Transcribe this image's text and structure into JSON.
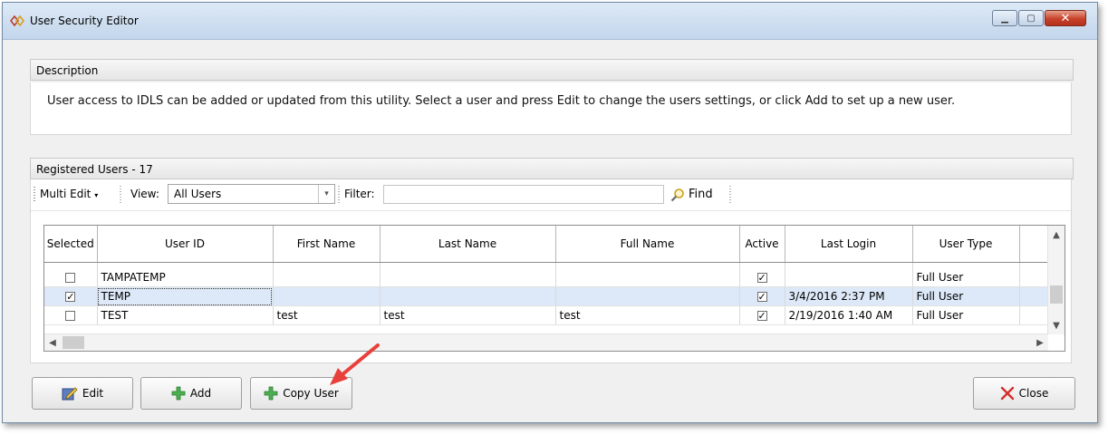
{
  "window": {
    "title": "User Security Editor"
  },
  "description": {
    "header": "Description",
    "text": "User access to IDLS can be added or updated from this utility.  Select a user and press Edit to change the users settings, or click Add to set up a new user."
  },
  "users": {
    "header": "Registered Users - 17",
    "toolbar": {
      "multi_edit": "Multi Edit",
      "view_label": "View:",
      "view_value": "All Users",
      "filter_label": "Filter:",
      "filter_value": "",
      "find_label": "Find"
    },
    "columns": [
      "Selected",
      "User ID",
      "First Name",
      "Last Name",
      "Full Name",
      "Active",
      "Last Login",
      "User Type"
    ],
    "rows": [
      {
        "selected": false,
        "user_id": "TAMPATEMP",
        "first": "",
        "last": "",
        "full": "",
        "active": true,
        "last_login": "",
        "user_type": "Full User"
      },
      {
        "selected": true,
        "user_id": "TEMP",
        "first": "",
        "last": "",
        "full": "",
        "active": true,
        "last_login": "3/4/2016 2:37 PM",
        "user_type": "Full User"
      },
      {
        "selected": false,
        "user_id": "TEST",
        "first": "test",
        "last": "test",
        "full": "test",
        "active": true,
        "last_login": "2/19/2016 1:40 AM",
        "user_type": "Full User"
      }
    ]
  },
  "buttons": {
    "edit": "Edit",
    "add": "Add",
    "copy_user": "Copy User",
    "close": "Close"
  },
  "colors": {
    "annotation_arrow": "#e8403a",
    "selected_row": "#dde9f8"
  }
}
